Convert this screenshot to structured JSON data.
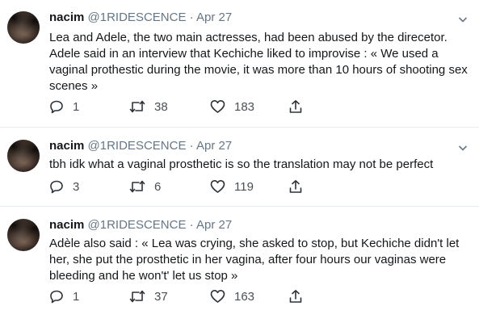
{
  "tweets": [
    {
      "name": "nacim",
      "handle": "@1RIDESCENCE",
      "dot": "·",
      "date": "Apr 27",
      "text": "Lea and Adele, the two main actresses, had been abused by the direcetor. Adele said in an interview that Kechiche liked to improvise : « We used a vaginal prothestic during the movie, it was more than 10 hours of shooting sex scenes »",
      "replies": "1",
      "retweets": "38",
      "likes": "183"
    },
    {
      "name": "nacim",
      "handle": "@1RIDESCENCE",
      "dot": "·",
      "date": "Apr 27",
      "text": "tbh idk what a vaginal prosthetic is so the translation may not be perfect",
      "replies": "3",
      "retweets": "6",
      "likes": "119"
    },
    {
      "name": "nacim",
      "handle": "@1RIDESCENCE",
      "dot": "·",
      "date": "Apr 27",
      "text": "Adèle also said : « Lea was crying, she asked to stop, but Kechiche didn't let her, she put the prosthetic in her vagina, after four hours our vaginas were bleeding and he won't' let us stop »",
      "replies": "1",
      "retweets": "37",
      "likes": "163"
    }
  ]
}
